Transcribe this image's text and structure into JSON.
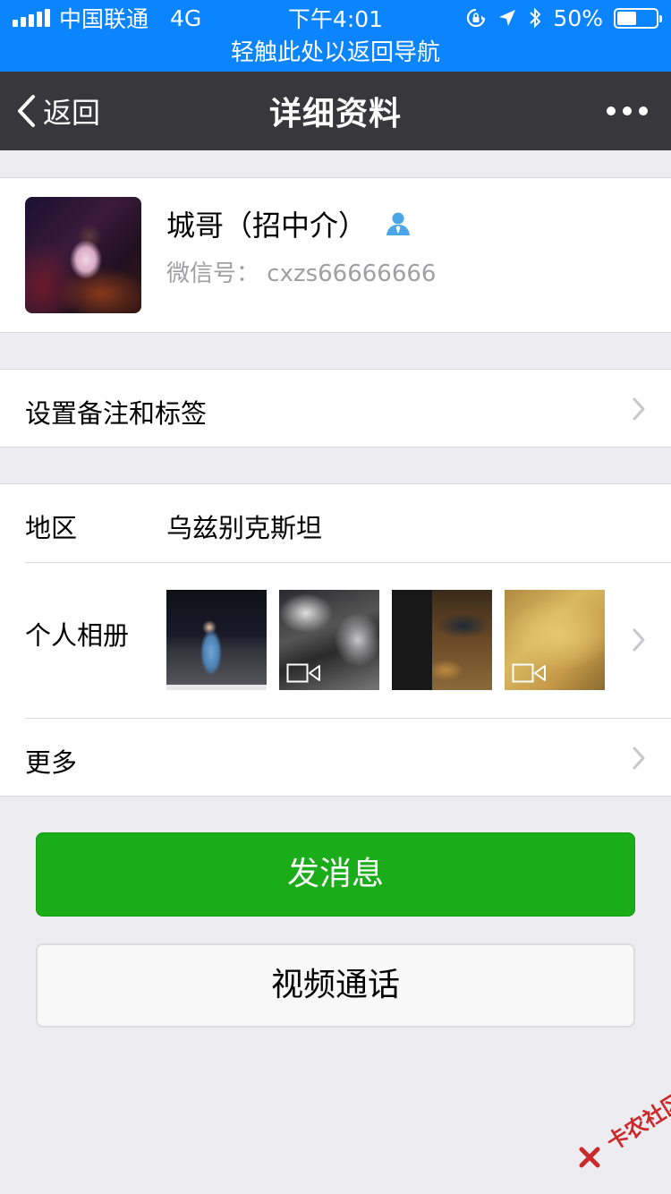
{
  "status_bar": {
    "carrier": "中国联通",
    "network": "4G",
    "time": "下午4:01",
    "battery": "50%",
    "battery_level": 0.5
  },
  "return_banner": {
    "text": "轻触此处以返回导航"
  },
  "nav": {
    "back_label": "返回",
    "title": "详细资料"
  },
  "profile": {
    "name": "城哥（招中介）",
    "wechat_id": "微信号：  cxzs66666666"
  },
  "remark": {
    "label": "设置备注和标签"
  },
  "info": {
    "region_label": "地区",
    "region_value": "乌兹别克斯坦",
    "album_label": "个人相册",
    "album_photos": [
      {
        "type": "image"
      },
      {
        "type": "video"
      },
      {
        "type": "image"
      },
      {
        "type": "video"
      }
    ],
    "more_label": "更多"
  },
  "actions": {
    "send_message": "发消息",
    "video_call": "视频通话"
  },
  "watermark": {
    "text": "卡农社区"
  },
  "colors": {
    "status_bar_bg": "#0b84ff",
    "nav_bg": "#38383c",
    "primary_green": "#1aad19",
    "page_bg": "#ececf1"
  }
}
